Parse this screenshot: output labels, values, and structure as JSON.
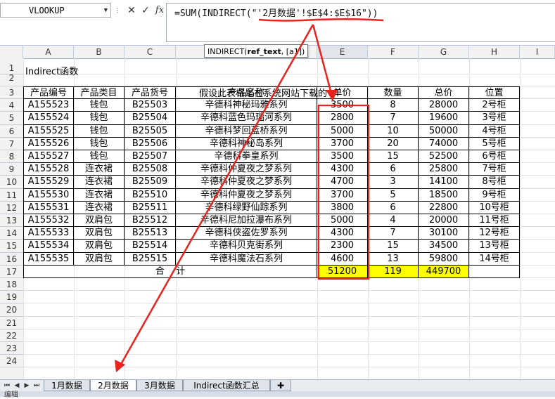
{
  "name_box": {
    "value": "VLOOKUP"
  },
  "formula_bar": {
    "cancel_icon": "✕",
    "confirm_icon": "✓",
    "fx_label": "fx",
    "formula": "=SUM(INDIRECT(\"'2月数据'!$E$4:$E$16\"))"
  },
  "tooltip": {
    "text": "INDIRECT(ref_text, [a1])",
    "bold_part": "ref_text"
  },
  "columns": [
    "A",
    "B",
    "C",
    "D",
    "E",
    "F",
    "G",
    "H",
    "I"
  ],
  "rows": [
    "1",
    "2",
    "3",
    "4",
    "5",
    "6",
    "7",
    "8",
    "9",
    "10",
    "11",
    "12",
    "13",
    "14",
    "15",
    "16",
    "17",
    "18",
    "19",
    "20",
    "21",
    "22",
    "23",
    "24"
  ],
  "sheet": {
    "a1": "Indirect函数",
    "subtitle": "假设此表格是在系统网站下载的",
    "headers": [
      "产品编号",
      "产品类目",
      "产品货号",
      "产品名称",
      "单价",
      "数量",
      "总价",
      "位置"
    ],
    "rows": [
      [
        "A155523",
        "钱包",
        "B25503",
        "辛德科神秘玛雅系列",
        "3500",
        "8",
        "28000",
        "2号柜"
      ],
      [
        "A155524",
        "钱包",
        "B25504",
        "辛德科蓝色玛瑙河系列",
        "2800",
        "7",
        "19600",
        "3号柜"
      ],
      [
        "A155525",
        "钱包",
        "B25505",
        "辛德科梦回蓝桥系列",
        "5000",
        "10",
        "50000",
        "4号柜"
      ],
      [
        "A155526",
        "钱包",
        "B25506",
        "辛德科神秘岛系列",
        "3700",
        "20",
        "74000",
        "5号柜"
      ],
      [
        "A155527",
        "钱包",
        "B25507",
        "辛德科拳皇系列",
        "3500",
        "15",
        "52500",
        "6号柜"
      ],
      [
        "A155528",
        "连衣裙",
        "B25508",
        "辛德科仲夏夜之梦系列",
        "4300",
        "6",
        "25800",
        "7号柜"
      ],
      [
        "A155529",
        "连衣裙",
        "B25509",
        "辛德科仲夏夜之梦系列",
        "4700",
        "3",
        "14100",
        "8号柜"
      ],
      [
        "A155530",
        "连衣裙",
        "B25510",
        "辛德科仲夏夜之梦系列",
        "3700",
        "5",
        "18500",
        "9号柜"
      ],
      [
        "A155531",
        "连衣裙",
        "B25511",
        "辛德科绿野仙踪系列",
        "3800",
        "6",
        "22800",
        "10号柜"
      ],
      [
        "A155532",
        "双肩包",
        "B25512",
        "辛德科尼加拉瀑布系列",
        "5000",
        "4",
        "20000",
        "11号柜"
      ],
      [
        "A155533",
        "双肩包",
        "B25513",
        "辛德科侠盗佐罗系列",
        "4300",
        "7",
        "30100",
        "12号柜"
      ],
      [
        "A155534",
        "双肩包",
        "B25514",
        "辛德科贝克街系列",
        "2300",
        "15",
        "34500",
        "13号柜"
      ],
      [
        "A155535",
        "双肩包",
        "B25515",
        "辛德科魔法石系列",
        "4600",
        "13",
        "59800",
        "14号柜"
      ]
    ],
    "total_label": "合    计",
    "totals": [
      "51200",
      "119",
      "449700"
    ]
  },
  "tabs": [
    "1月数据",
    "2月数据",
    "3月数据",
    "Indirect函数汇总"
  ],
  "active_tab": "2月数据",
  "status": {
    "text": "编辑"
  },
  "colors": {
    "highlight_red": "#e8231c",
    "total_yellow": "#ffff00"
  }
}
